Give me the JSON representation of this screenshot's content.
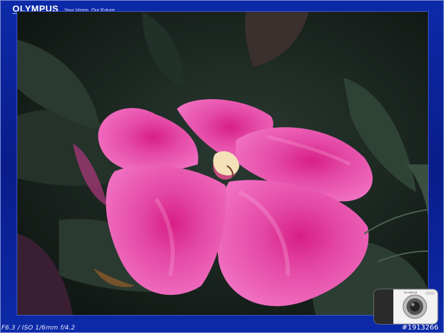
{
  "brand": {
    "logo": "OLYMPUS",
    "tagline": "Your Vision, Our Future"
  },
  "photo": {
    "subject": "pink impatiens flower",
    "colors": {
      "petal": "#e0389a",
      "petal_light": "#f27ac2",
      "center": "#f4e1b8",
      "leaves": "#2a3a30",
      "frame": "#0a1c8a"
    }
  },
  "caption": {
    "exif": "F6.3 / ISO 1/6mm f/4.2"
  },
  "image_id": "#1913266",
  "camera_icon": "olympus-pen-camera-icon",
  "camera_label": "OLYMPUS"
}
